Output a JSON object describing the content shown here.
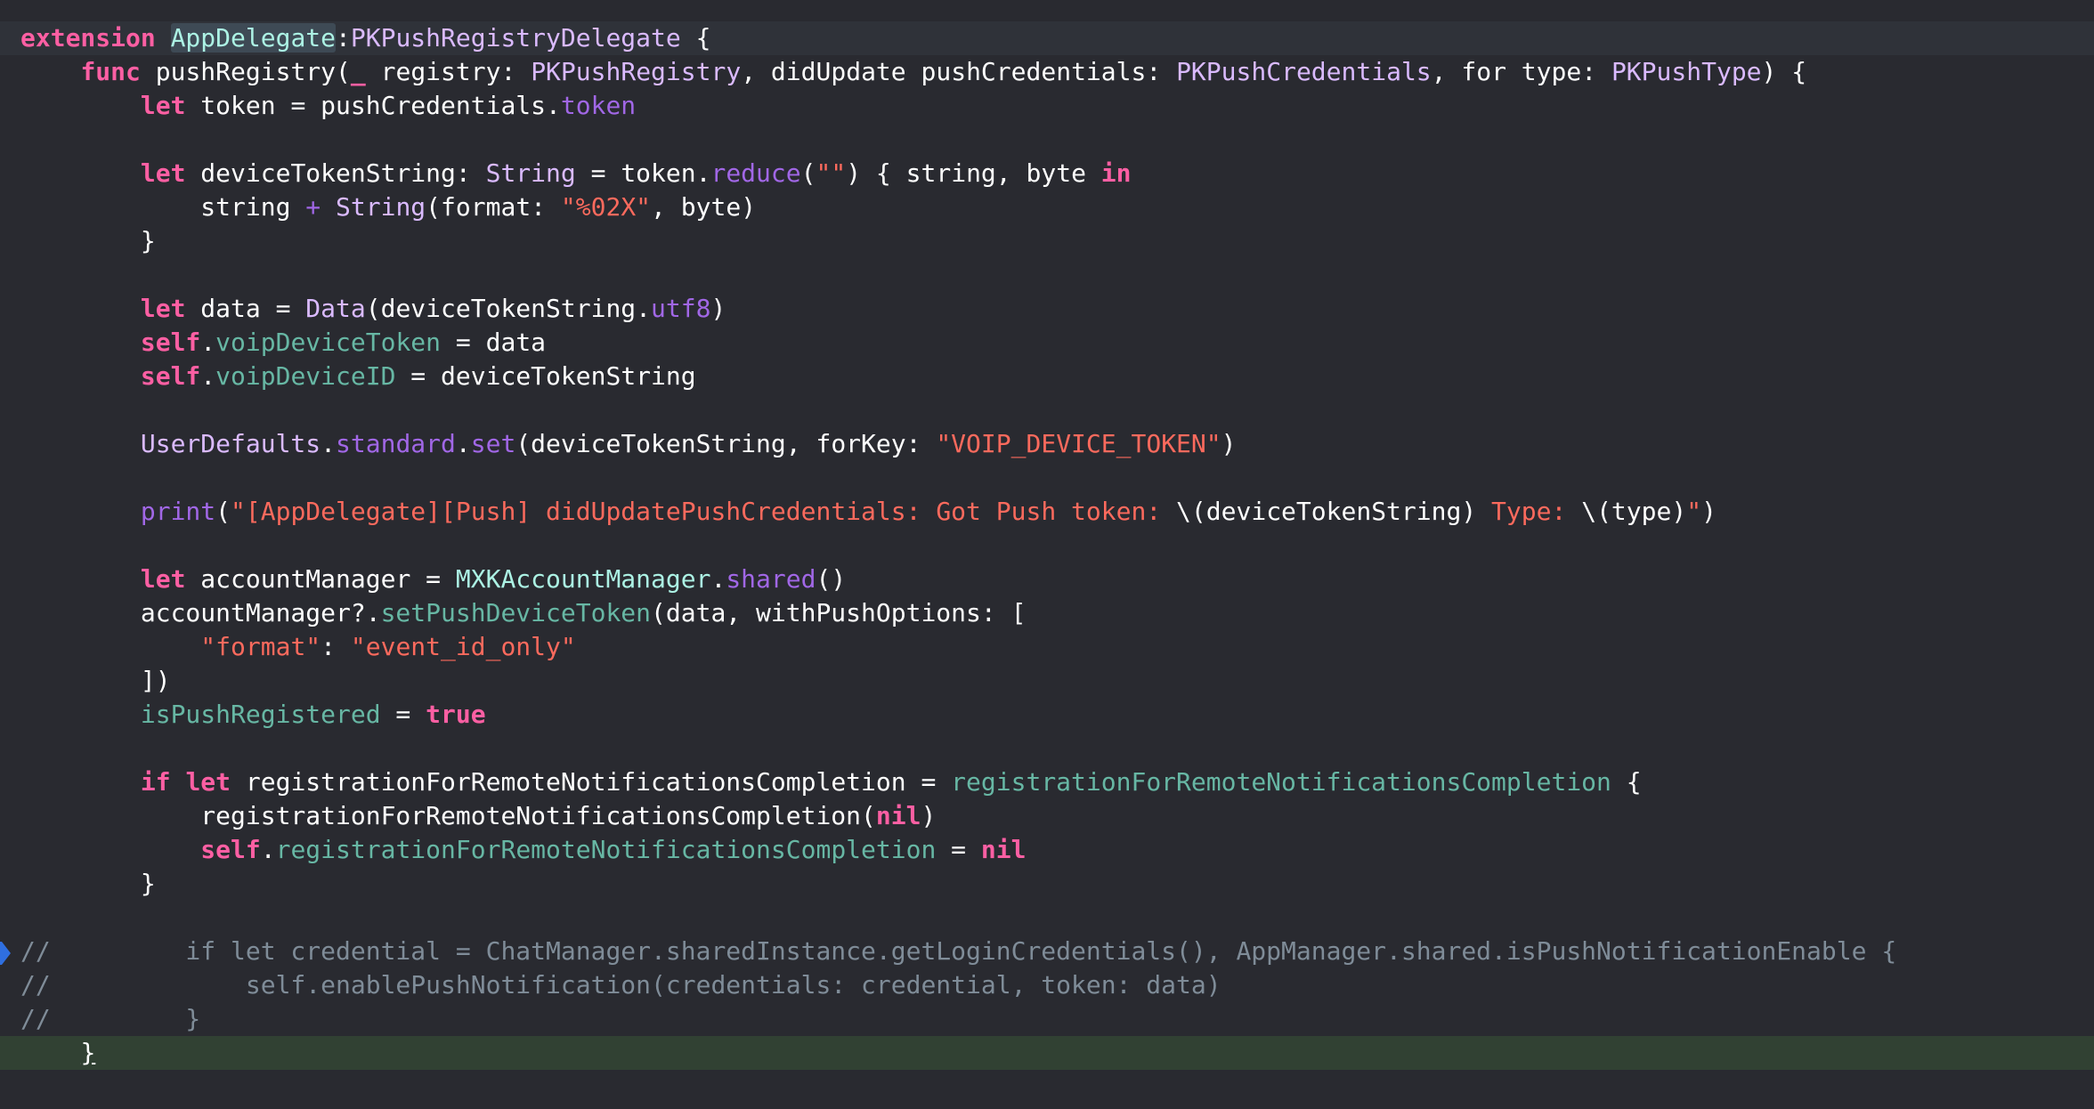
{
  "editor": {
    "language": "Swift",
    "colors": {
      "background": "#292a30",
      "current_line": "#2f3239",
      "changed_line": "#314133",
      "keyword": "#fc5fa3",
      "type": "#dabaff",
      "project_type": "#acf2e4",
      "function": "#a167e6",
      "property": "#67b7a4",
      "string": "#fc6a5d",
      "comment": "#7f8c98",
      "plain": "#ffffff",
      "breakpoint": "#2f6fe0"
    },
    "gutter_marker": "breakpoint-icon",
    "lines": [
      [
        [
          "kw",
          "extension"
        ],
        [
          "plain",
          " "
        ],
        [
          "typeproj_hl",
          "AppDelegate"
        ],
        [
          "plain",
          ":"
        ],
        [
          "type",
          "PKPushRegistryDelegate"
        ],
        [
          "plain",
          " {"
        ]
      ],
      [
        [
          "plain",
          "    "
        ],
        [
          "kw",
          "func"
        ],
        [
          "plain",
          " pushRegistry("
        ],
        [
          "kw",
          "_"
        ],
        [
          "plain",
          " registry: "
        ],
        [
          "type",
          "PKPushRegistry"
        ],
        [
          "plain",
          ", didUpdate pushCredentials: "
        ],
        [
          "type",
          "PKPushCredentials"
        ],
        [
          "plain",
          ", for type: "
        ],
        [
          "type",
          "PKPushType"
        ],
        [
          "plain",
          ") {"
        ]
      ],
      [
        [
          "plain",
          "        "
        ],
        [
          "kw",
          "let"
        ],
        [
          "plain",
          " token = pushCredentials."
        ],
        [
          "fn",
          "token"
        ]
      ],
      [],
      [
        [
          "plain",
          "        "
        ],
        [
          "kw",
          "let"
        ],
        [
          "plain",
          " deviceTokenString: "
        ],
        [
          "type",
          "String"
        ],
        [
          "plain",
          " = token."
        ],
        [
          "fn",
          "reduce"
        ],
        [
          "plain",
          "("
        ],
        [
          "str",
          "\"\""
        ],
        [
          "plain",
          ") { string, byte "
        ],
        [
          "kw",
          "in"
        ]
      ],
      [
        [
          "plain",
          "            string "
        ],
        [
          "fn",
          "+"
        ],
        [
          "plain",
          " "
        ],
        [
          "type",
          "String"
        ],
        [
          "plain",
          "(format: "
        ],
        [
          "str",
          "\"%02X\""
        ],
        [
          "plain",
          ", byte)"
        ]
      ],
      [
        [
          "plain",
          "        }"
        ]
      ],
      [],
      [
        [
          "plain",
          "        "
        ],
        [
          "kw",
          "let"
        ],
        [
          "plain",
          " data = "
        ],
        [
          "type",
          "Data"
        ],
        [
          "plain",
          "(deviceTokenString."
        ],
        [
          "fn",
          "utf8"
        ],
        [
          "plain",
          ")"
        ]
      ],
      [
        [
          "plain",
          "        "
        ],
        [
          "kw",
          "self"
        ],
        [
          "plain",
          "."
        ],
        [
          "prop",
          "voipDeviceToken"
        ],
        [
          "plain",
          " = data"
        ]
      ],
      [
        [
          "plain",
          "        "
        ],
        [
          "kw",
          "self"
        ],
        [
          "plain",
          "."
        ],
        [
          "prop",
          "voipDeviceID"
        ],
        [
          "plain",
          " = deviceTokenString"
        ]
      ],
      [],
      [
        [
          "plain",
          "        "
        ],
        [
          "type",
          "UserDefaults"
        ],
        [
          "plain",
          "."
        ],
        [
          "fn",
          "standard"
        ],
        [
          "plain",
          "."
        ],
        [
          "fn",
          "set"
        ],
        [
          "plain",
          "(deviceTokenString, forKey: "
        ],
        [
          "str",
          "\"VOIP_DEVICE_TOKEN\""
        ],
        [
          "plain",
          ")"
        ]
      ],
      [],
      [
        [
          "plain",
          "        "
        ],
        [
          "fn",
          "print"
        ],
        [
          "plain",
          "("
        ],
        [
          "str",
          "\"[AppDelegate][Push] didUpdatePushCredentials: Got Push token: "
        ],
        [
          "plain",
          "\\(deviceTokenString)"
        ],
        [
          "str",
          " Type: "
        ],
        [
          "plain",
          "\\(type)"
        ],
        [
          "str",
          "\""
        ],
        [
          "plain",
          ")"
        ]
      ],
      [],
      [
        [
          "plain",
          "        "
        ],
        [
          "kw",
          "let"
        ],
        [
          "plain",
          " accountManager = "
        ],
        [
          "typeproj",
          "MXKAccountManager"
        ],
        [
          "plain",
          "."
        ],
        [
          "fn",
          "shared"
        ],
        [
          "plain",
          "()"
        ]
      ],
      [
        [
          "plain",
          "        accountManager?."
        ],
        [
          "prop",
          "setPushDeviceToken"
        ],
        [
          "plain",
          "(data, withPushOptions: ["
        ]
      ],
      [
        [
          "plain",
          "            "
        ],
        [
          "str",
          "\"format\""
        ],
        [
          "plain",
          ": "
        ],
        [
          "str",
          "\"event_id_only\""
        ]
      ],
      [
        [
          "plain",
          "        ])"
        ]
      ],
      [
        [
          "plain",
          "        "
        ],
        [
          "prop",
          "isPushRegistered"
        ],
        [
          "plain",
          " = "
        ],
        [
          "kw",
          "true"
        ]
      ],
      [],
      [
        [
          "plain",
          "        "
        ],
        [
          "kw",
          "if"
        ],
        [
          "plain",
          " "
        ],
        [
          "kw",
          "let"
        ],
        [
          "plain",
          " registrationForRemoteNotificationsCompletion = "
        ],
        [
          "prop",
          "registrationForRemoteNotificationsCompletion"
        ],
        [
          "plain",
          " {"
        ]
      ],
      [
        [
          "plain",
          "            registrationForRemoteNotificationsCompletion("
        ],
        [
          "kw",
          "nil"
        ],
        [
          "plain",
          ")"
        ]
      ],
      [
        [
          "plain",
          "            "
        ],
        [
          "kw",
          "self"
        ],
        [
          "plain",
          "."
        ],
        [
          "prop",
          "registrationForRemoteNotificationsCompletion"
        ],
        [
          "plain",
          " = "
        ],
        [
          "kw",
          "nil"
        ]
      ],
      [
        [
          "plain",
          "        }"
        ]
      ],
      [],
      [
        [
          "cmt",
          "//         if let credential = ChatManager.sharedInstance.getLoginCredentials(), AppManager.shared.isPushNotificationEnable {"
        ]
      ],
      [
        [
          "cmt",
          "//             self.enablePushNotification(credentials: credential, token: data)"
        ]
      ],
      [
        [
          "cmt",
          "//         }"
        ]
      ],
      [
        [
          "plain",
          "    "
        ],
        [
          "plain_caret",
          "}"
        ]
      ]
    ]
  }
}
